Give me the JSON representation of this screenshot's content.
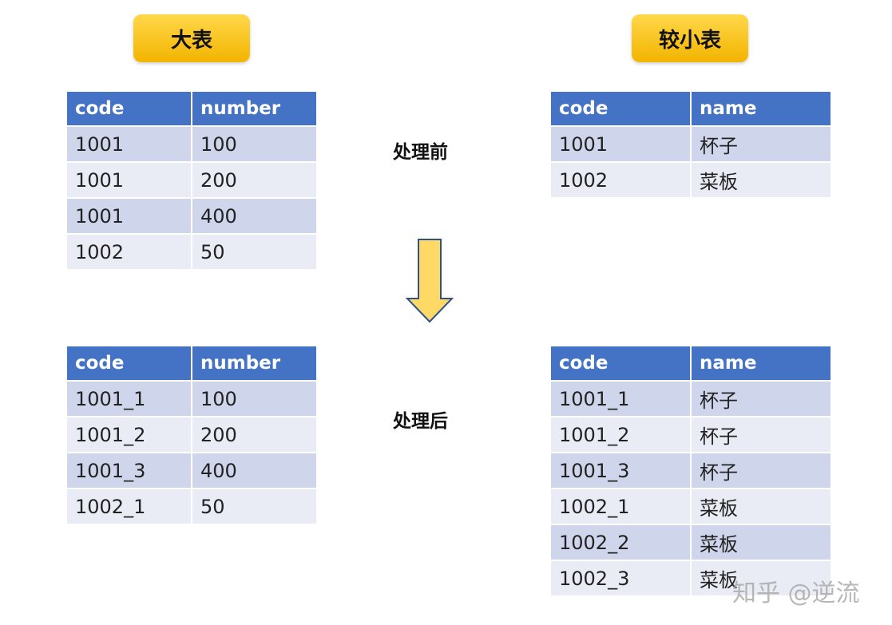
{
  "badges": {
    "big": "大表",
    "small": "较小表"
  },
  "labels": {
    "before": "处理前",
    "after": "处理后"
  },
  "tables": {
    "big_before": {
      "headers": [
        "code",
        "number"
      ],
      "rows": [
        [
          "1001",
          "100"
        ],
        [
          "1001",
          "200"
        ],
        [
          "1001",
          "400"
        ],
        [
          "1002",
          "50"
        ]
      ]
    },
    "small_before": {
      "headers": [
        "code",
        "name"
      ],
      "rows": [
        [
          "1001",
          "杯子"
        ],
        [
          "1002",
          "菜板"
        ]
      ]
    },
    "big_after": {
      "headers": [
        "code",
        "number"
      ],
      "rows": [
        [
          "1001_1",
          "100"
        ],
        [
          "1001_2",
          "200"
        ],
        [
          "1001_3",
          "400"
        ],
        [
          "1002_1",
          "50"
        ]
      ]
    },
    "small_after": {
      "headers": [
        "code",
        "name"
      ],
      "rows": [
        [
          "1001_1",
          "杯子"
        ],
        [
          "1001_2",
          "杯子"
        ],
        [
          "1001_3",
          "杯子"
        ],
        [
          "1002_1",
          "菜板"
        ],
        [
          "1002_2",
          "菜板"
        ],
        [
          "1002_3",
          "菜板"
        ]
      ]
    }
  },
  "watermark": "知乎 @逆流",
  "colors": {
    "header_bg": "#4472c4",
    "row_odd": "#cfd5ea",
    "row_even": "#e9ebf5",
    "badge": "#f7c21a",
    "arrow_fill": "#ffd966",
    "arrow_stroke": "#2f528f"
  },
  "icons": {
    "arrow": "down-arrow-icon"
  }
}
